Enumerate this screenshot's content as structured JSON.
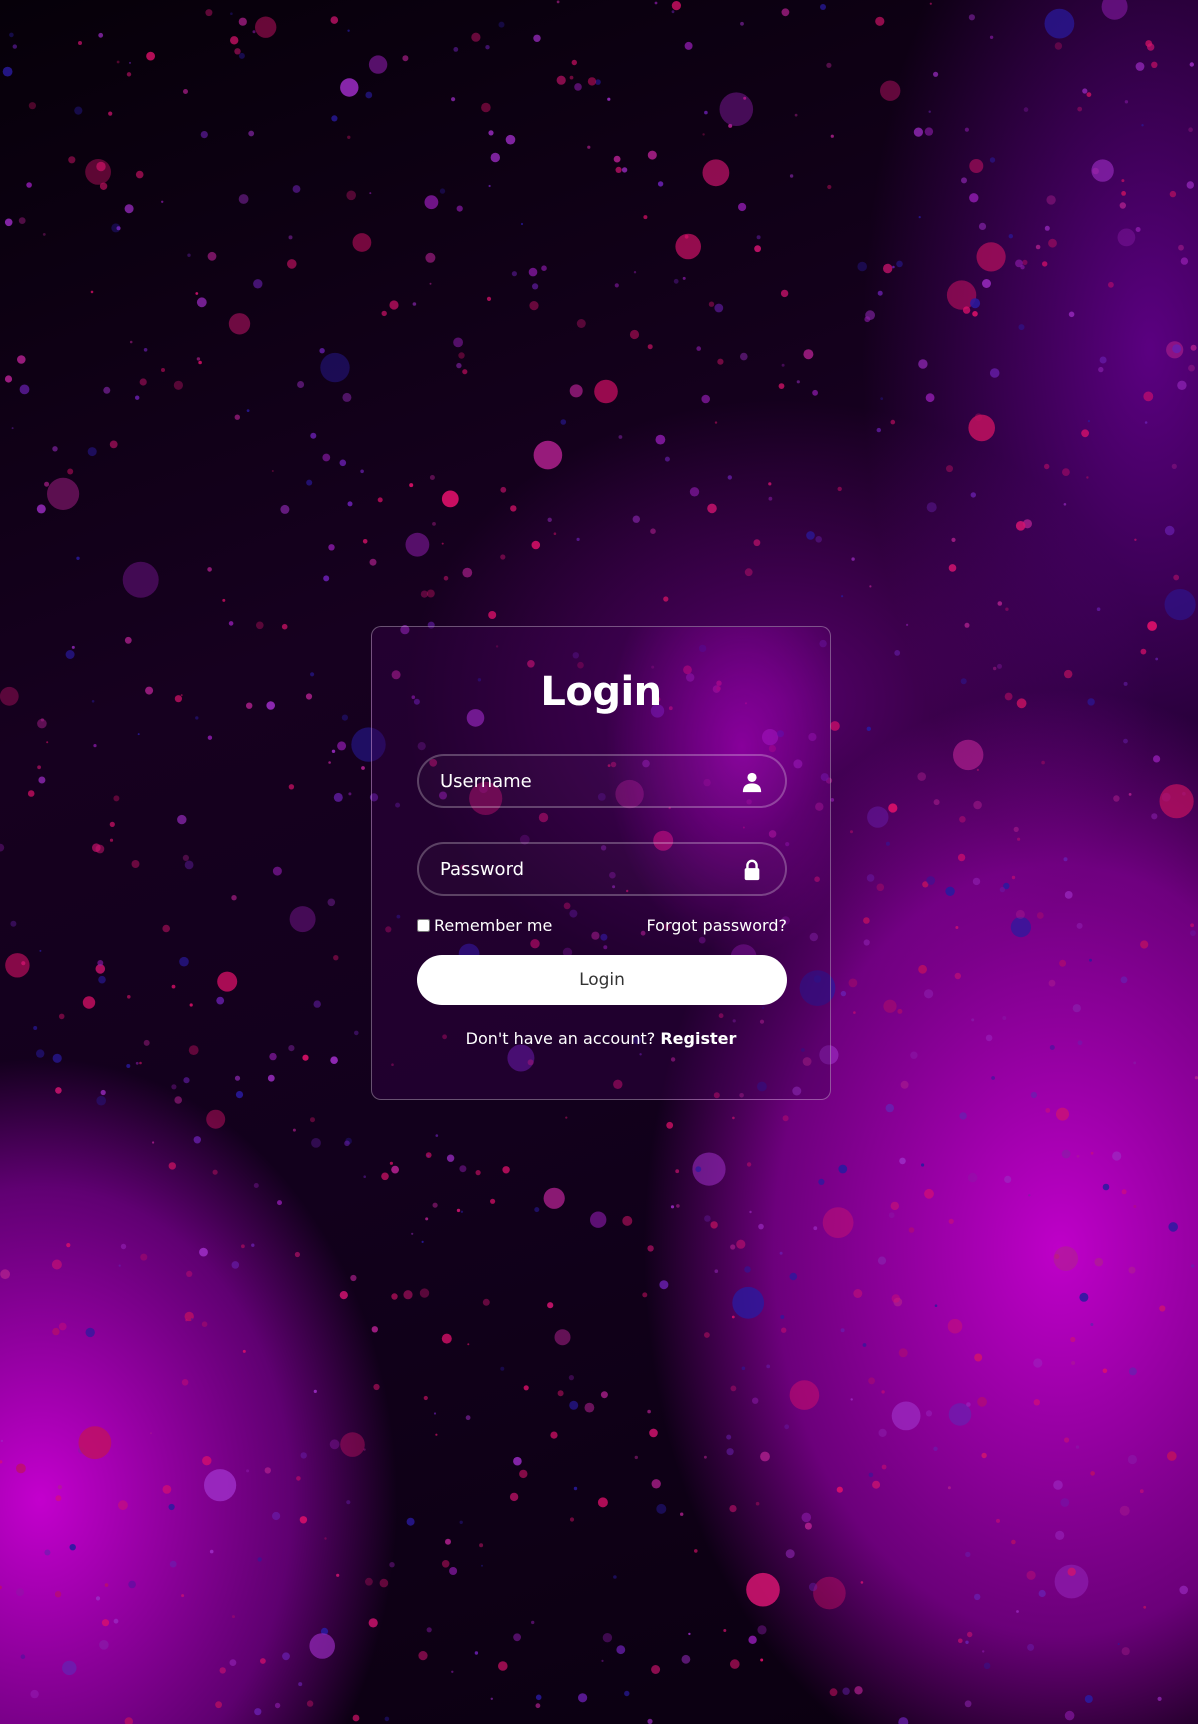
{
  "login_form": {
    "title": "Login",
    "username": {
      "placeholder": "Username",
      "value": "",
      "icon": "user-icon"
    },
    "password": {
      "placeholder": "Password",
      "value": "",
      "icon": "lock-icon"
    },
    "remember_label": "Remember me",
    "remember_checked": false,
    "forgot_label": "Forgot password?",
    "submit_label": "Login",
    "register_prompt": "Don't have an account?",
    "register_label": "Register"
  },
  "colors": {
    "accent": "#c000d0",
    "button_bg": "#ffffff",
    "button_text": "#333333",
    "text": "#ffffff"
  }
}
